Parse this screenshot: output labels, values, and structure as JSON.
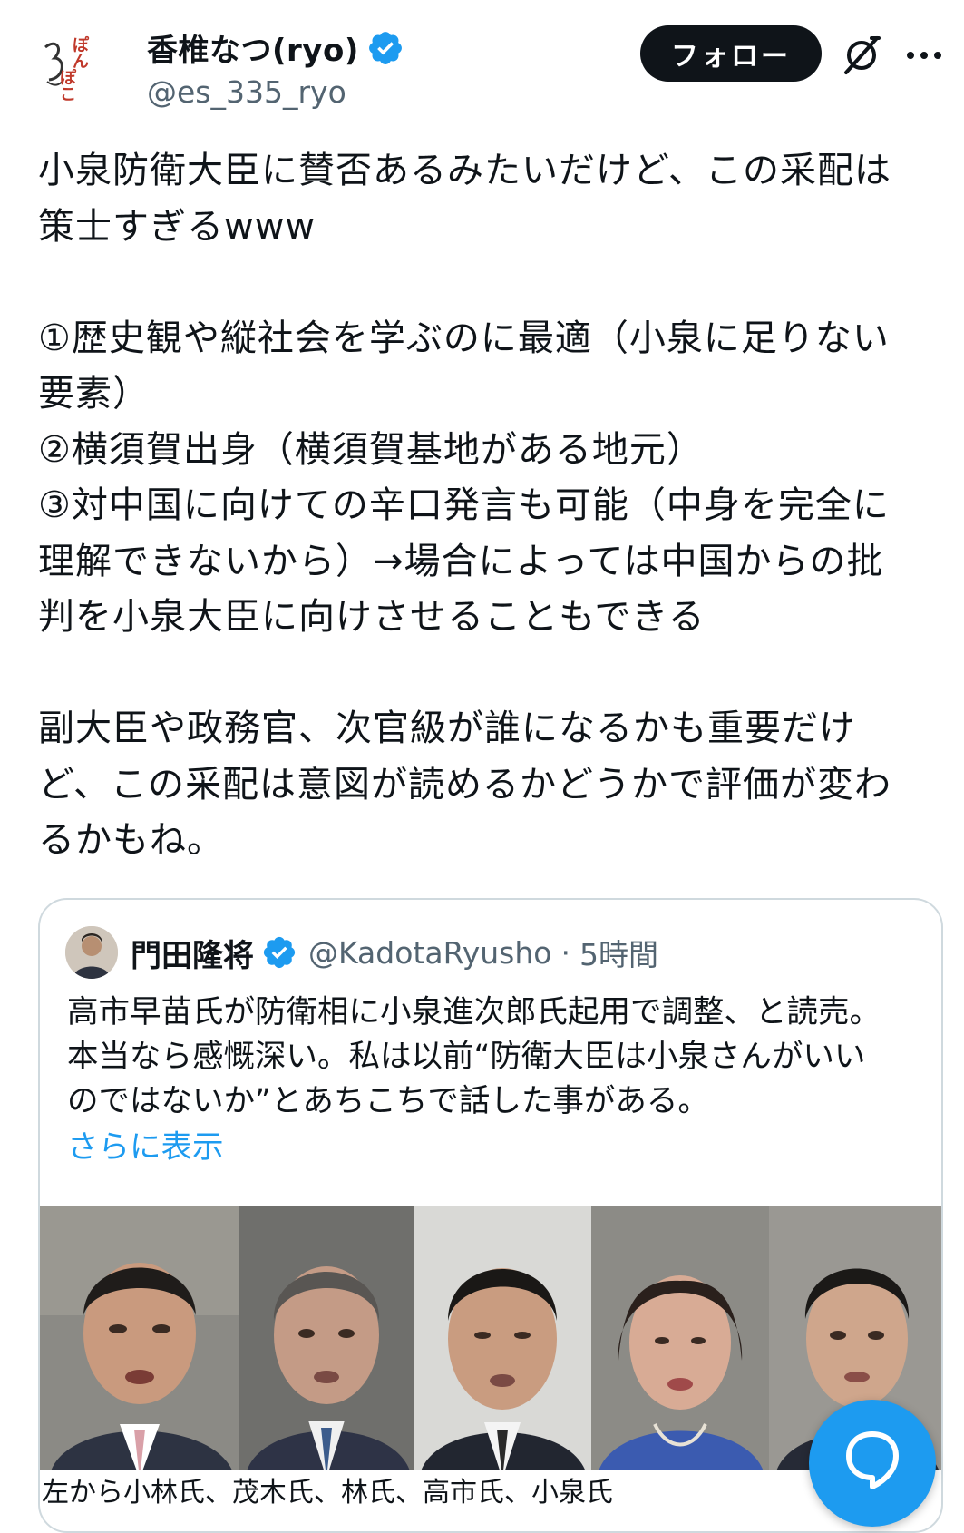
{
  "author": {
    "display_name": "香椎なつ(ryo)",
    "handle": "@es_335_ryo",
    "follow_label": "フォロー",
    "avatar_text": "ぽんぽこ"
  },
  "tweet": {
    "paragraphs": [
      "小泉防衛大臣に賛否あるみたいだけど、この采配は\n策士すぎるwww",
      "①歴史観や縦社会を学ぶのに最適（小泉に足りない\n要素）\n②横須賀出身（横須賀基地がある地元）\n③対中国に向けての辛口発言も可能（中身を完全に\n理解できないから）→場合によっては中国からの批\n判を小泉大臣に向けさせることもできる",
      "副大臣や政務官、次官級が誰になるかも重要だけ\nど、この采配は意図が読めるかどうかで評価が変わ\nるかもね。"
    ]
  },
  "quoted": {
    "display_name": "門田隆将",
    "handle": "@KadotaRyusho",
    "separator": "·",
    "time": "5時間",
    "text": "高市早苗氏が防衛相に小泉進次郎氏起用で調整、と読売。\n本当なら感慨深い。私は以前“防衛大臣は小泉さんがいい\nのではないか”とあちこちで話した事がある。",
    "show_more": "さらに表示",
    "caption": "左から小林氏、茂木氏、林氏、高市氏、小泉氏"
  },
  "colors": {
    "accent": "#1d9bf0",
    "text": "#0f1419",
    "secondary": "#536471",
    "border": "#cfd9de"
  },
  "icons": {
    "verified": "verified-badge-icon",
    "grok": "grok-icon",
    "more": "more-options-icon",
    "fab": "compose-reply-icon"
  }
}
